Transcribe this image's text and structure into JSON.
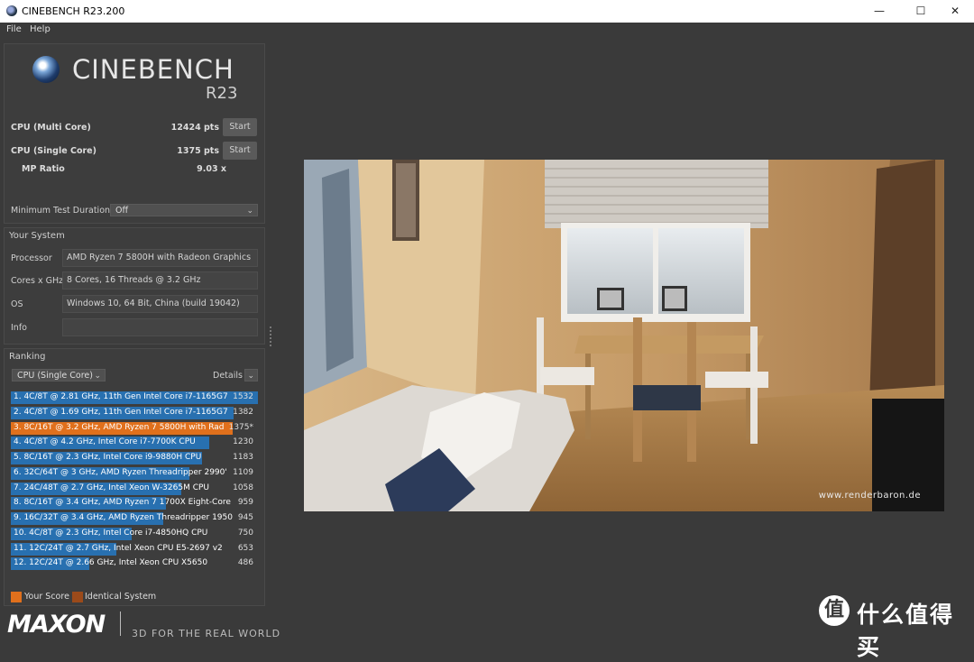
{
  "window": {
    "title": "CINEBENCH R23.200"
  },
  "menu": [
    "File",
    "Help"
  ],
  "logo": {
    "name": "CINEBENCH",
    "version": "R23"
  },
  "scores": [
    {
      "label": "CPU (Multi Core)",
      "value": "12424 pts",
      "button": "Start"
    },
    {
      "label": "CPU (Single Core)",
      "value": "1375 pts",
      "button": "Start"
    }
  ],
  "mp_ratio": {
    "label": "MP Ratio",
    "value": "9.03 x"
  },
  "min_duration": {
    "label": "Minimum Test Duration",
    "value": "Off"
  },
  "system": {
    "title": "Your System",
    "rows": [
      {
        "label": "Processor",
        "value": "AMD Ryzen 7 5800H with Radeon Graphics"
      },
      {
        "label": "Cores x GHz",
        "value": "8 Cores, 16 Threads @ 3.2 GHz"
      },
      {
        "label": "OS",
        "value": "Windows 10, 64 Bit, China (build 19042)"
      },
      {
        "label": "Info",
        "value": ""
      }
    ]
  },
  "ranking": {
    "title": "Ranking",
    "mode": "CPU (Single Core)",
    "details": "Details",
    "rows": [
      {
        "text": "1. 4C/8T @ 2.81 GHz, 11th Gen Intel Core i7-1165G7",
        "score": "1532",
        "fill": 1.0,
        "you": false
      },
      {
        "text": "2. 4C/8T @ 1.69 GHz, 11th Gen Intel Core i7-1165G7",
        "score": "1382",
        "fill": 0.902,
        "you": false
      },
      {
        "text": "3. 8C/16T @ 3.2 GHz, AMD Ryzen 7 5800H with Rad",
        "score": "1375*",
        "fill": 0.898,
        "you": true
      },
      {
        "text": "4. 4C/8T @ 4.2 GHz, Intel Core i7-7700K CPU",
        "score": "1230",
        "fill": 0.803,
        "you": false
      },
      {
        "text": "5. 8C/16T @ 2.3 GHz, Intel Core i9-9880H CPU",
        "score": "1183",
        "fill": 0.772,
        "you": false
      },
      {
        "text": "6. 32C/64T @ 3 GHz, AMD Ryzen Threadripper 2990'",
        "score": "1109",
        "fill": 0.724,
        "you": false
      },
      {
        "text": "7. 24C/48T @ 2.7 GHz, Intel Xeon W-3265M CPU",
        "score": "1058",
        "fill": 0.691,
        "you": false
      },
      {
        "text": "8. 8C/16T @ 3.4 GHz, AMD Ryzen 7 1700X Eight-Core",
        "score": "959",
        "fill": 0.626,
        "you": false
      },
      {
        "text": "9. 16C/32T @ 3.4 GHz, AMD Ryzen Threadripper 1950",
        "score": "945",
        "fill": 0.617,
        "you": false
      },
      {
        "text": "10. 4C/8T @ 2.3 GHz, Intel Core i7-4850HQ CPU",
        "score": "750",
        "fill": 0.49,
        "you": false
      },
      {
        "text": "11. 12C/24T @ 2.7 GHz, Intel Xeon CPU E5-2697 v2",
        "score": "653",
        "fill": 0.426,
        "you": false
      },
      {
        "text": "12. 12C/24T @ 2.66 GHz, Intel Xeon CPU X5650",
        "score": "486",
        "fill": 0.317,
        "you": false
      }
    ]
  },
  "legend": {
    "your_score": "Your Score",
    "identical": "Identical System",
    "your_color": "#e0701c",
    "identical_color": "#9b4a1a"
  },
  "footer": {
    "brand": "MAXON",
    "tagline": "3D FOR THE REAL WORLD"
  },
  "render": {
    "watermark": "www.renderbaron.de"
  },
  "overlay": {
    "site": "什么值得买",
    "badge": "值"
  }
}
